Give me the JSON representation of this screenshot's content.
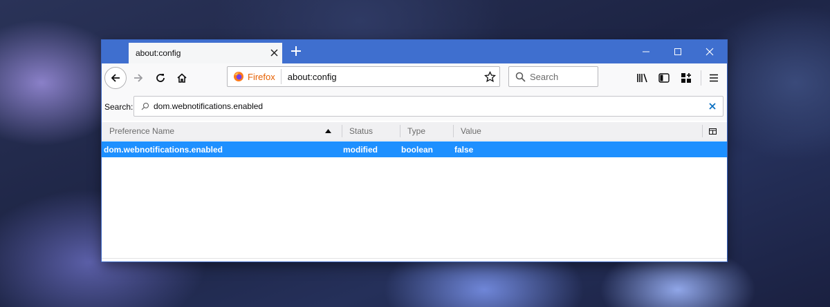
{
  "tab": {
    "title": "about:config",
    "close_icon": "close-icon"
  },
  "new_tab_icon": "plus-icon",
  "window_controls": [
    "minimize-icon",
    "maximize-icon",
    "close-icon"
  ],
  "toolbar": {
    "identity_label": "Firefox",
    "url": "about:config",
    "search_placeholder": "Search"
  },
  "filter": {
    "label": "Search:",
    "value": "dom.webnotifications.enabled"
  },
  "table": {
    "columns": [
      "Preference Name",
      "Status",
      "Type",
      "Value"
    ],
    "sort_column": "Preference Name",
    "rows": [
      {
        "name": "dom.webnotifications.enabled",
        "status": "modified",
        "type": "boolean",
        "value": "false"
      }
    ]
  },
  "colors": {
    "titlebar": "#3f6fcf",
    "selected_row": "#1e90ff",
    "firefox_label": "#e66000",
    "clear_x": "#0a6fc2"
  }
}
